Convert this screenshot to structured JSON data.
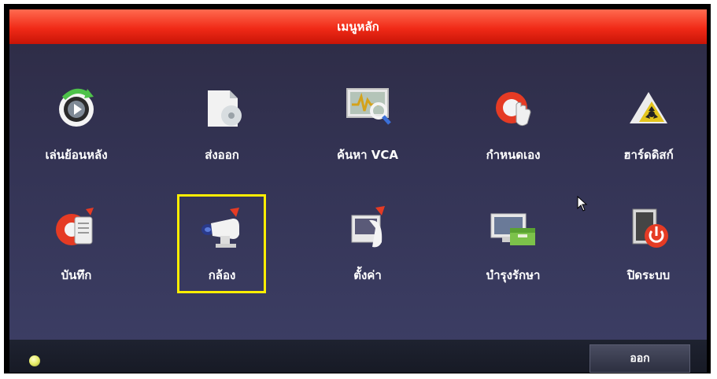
{
  "window": {
    "title": "เมนูหลัก"
  },
  "menu": {
    "items": [
      {
        "label": "เล่นย้อนหลัง",
        "icon": "playback-icon"
      },
      {
        "label": "ส่งออก",
        "icon": "export-icon"
      },
      {
        "label": "ค้นหา VCA",
        "icon": "vca-search-icon"
      },
      {
        "label": "กำหนดเอง",
        "icon": "custom-icon"
      },
      {
        "label": "ฮาร์ดดิสก์",
        "icon": "hdd-icon"
      },
      {
        "label": "บันทึก",
        "icon": "record-icon"
      },
      {
        "label": "กล้อง",
        "icon": "camera-icon",
        "selected": true
      },
      {
        "label": "ตั้งค่า",
        "icon": "settings-icon"
      },
      {
        "label": "บำรุงรักษา",
        "icon": "maintenance-icon"
      },
      {
        "label": "ปิดระบบ",
        "icon": "shutdown-icon"
      }
    ]
  },
  "footer": {
    "exit_label": "ออก"
  },
  "colors": {
    "titlebar": "#f02a17",
    "highlight": "#ffee00",
    "background": "#343455"
  }
}
